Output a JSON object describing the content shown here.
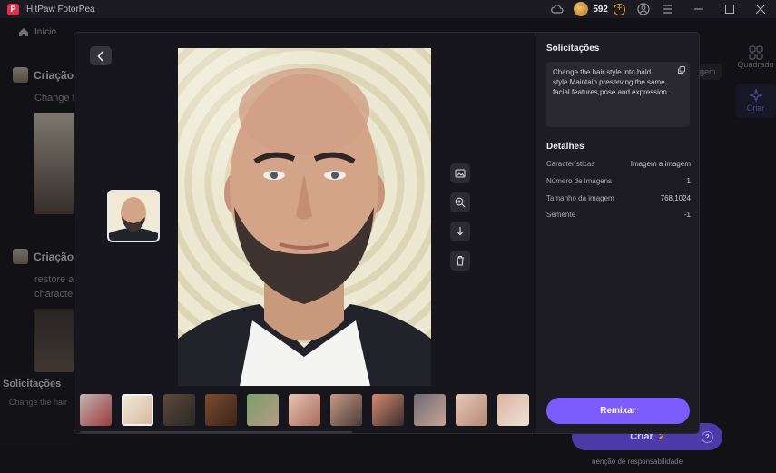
{
  "titlebar": {
    "app_title": "HitPaw FotorPea",
    "logo_letter": "P",
    "credits": "592"
  },
  "background": {
    "home_label": "Início",
    "creations": [
      {
        "title": "Criação",
        "prompt_lines": [
          "Change t"
        ]
      },
      {
        "title": "Criação",
        "prompt_lines": [
          "restore a",
          "characte"
        ]
      }
    ],
    "solicitacoes_title": "Solicitações",
    "solicitacoes_text": "Change the hair",
    "partial_button": "gem",
    "rail": [
      {
        "label": "Quadrado",
        "icon": "grid-icon"
      },
      {
        "label": "Criar",
        "icon": "sparkle-icon"
      }
    ],
    "criar_button": "Criar",
    "criar_cost": "2",
    "disclaimer": "nenção de responsabilidade"
  },
  "modal": {
    "panel": {
      "requests_title": "Solicitações",
      "prompt": "Change the hair style into bald style.Maintain preserving the same facial features,pose and expression.",
      "details_title": "Detalhes",
      "details": [
        {
          "label": "Características",
          "value": "Imagem a imagem"
        },
        {
          "label": "Número de imagens",
          "value": "1"
        },
        {
          "label": "Tamanho da imagem",
          "value": "768,1024"
        },
        {
          "label": "Semente",
          "value": "-1"
        }
      ],
      "remix_label": "Remixar"
    },
    "tools": [
      "image-edit-icon",
      "zoom-in-icon",
      "download-icon",
      "trash-icon"
    ],
    "thumbnails": [
      {
        "colors": [
          "#c4b3b0",
          "#9b3b40"
        ]
      },
      {
        "colors": [
          "#efe9d6",
          "#d9b89e"
        ],
        "selected": true
      },
      {
        "colors": [
          "#5b4a3c",
          "#2b2724"
        ]
      },
      {
        "colors": [
          "#7d4b2e",
          "#3b2418"
        ]
      },
      {
        "colors": [
          "#7aa06a",
          "#b89a84"
        ]
      },
      {
        "colors": [
          "#e6c3b4",
          "#a86b5a"
        ]
      },
      {
        "colors": [
          "#c99a84",
          "#4a3b3a"
        ]
      },
      {
        "colors": [
          "#d78a6f",
          "#3a2e2e"
        ]
      },
      {
        "colors": [
          "#6e6a75",
          "#c9a495"
        ]
      },
      {
        "colors": [
          "#e7c8b9",
          "#b58873"
        ]
      },
      {
        "colors": [
          "#d9b3a0",
          "#f1e2d6"
        ]
      }
    ]
  }
}
